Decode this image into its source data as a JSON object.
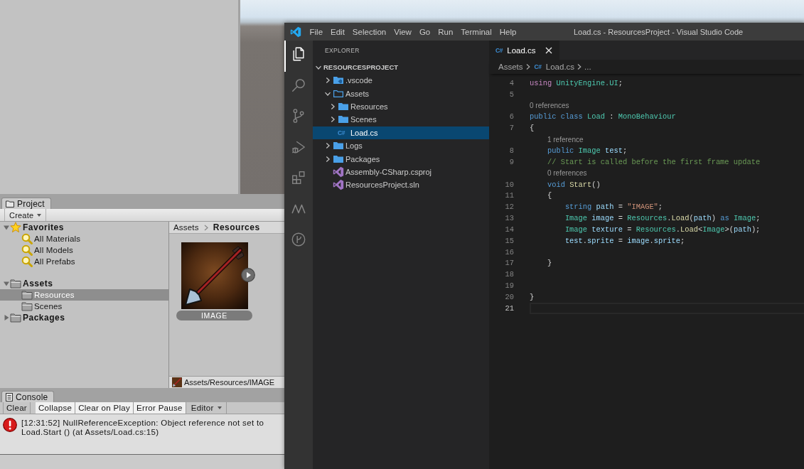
{
  "unity": {
    "project": {
      "tab": "Project",
      "create_button": "Create",
      "tree": [
        {
          "label": "Favorites",
          "kind": "favorites",
          "expanded": true,
          "selected": false,
          "children": [
            {
              "label": "All Materials",
              "kind": "search",
              "selected": false
            },
            {
              "label": "All Models",
              "kind": "search",
              "selected": false
            },
            {
              "label": "All Prefabs",
              "kind": "search",
              "selected": false
            }
          ]
        },
        {
          "label": "Assets",
          "kind": "folder",
          "expanded": true,
          "selected": false,
          "children": [
            {
              "label": "Resources",
              "kind": "folder",
              "selected": true
            },
            {
              "label": "Scenes",
              "kind": "folder",
              "selected": false
            }
          ]
        },
        {
          "label": "Packages",
          "kind": "folder",
          "expanded": false,
          "selected": false
        }
      ],
      "breadcrumb": [
        "Assets",
        "Resources"
      ],
      "assets": [
        {
          "label": "IMAGE",
          "selected": true
        }
      ],
      "path_bar": "Assets/Resources/IMAGE"
    },
    "console": {
      "tab": "Console",
      "toolbar": [
        {
          "label": "Clear",
          "kind": "button"
        },
        {
          "label": "Collapse",
          "kind": "toggle",
          "on": true
        },
        {
          "label": "Clear on Play",
          "kind": "toggle",
          "on": true
        },
        {
          "label": "Error Pause",
          "kind": "toggle",
          "on": true
        },
        {
          "label": "Editor",
          "kind": "dropdown"
        }
      ],
      "messages": [
        {
          "kind": "error",
          "lines": [
            "[12:31:52] NullReferenceException: Object reference not set to",
            "Load.Start () (at Assets/Load.cs:15)"
          ]
        }
      ]
    }
  },
  "vscode": {
    "menu": [
      "File",
      "Edit",
      "Selection",
      "View",
      "Go",
      "Run",
      "Terminal",
      "Help"
    ],
    "title": "Load.cs - ResourcesProject - Visual Studio Code",
    "activity_bar": [
      {
        "kind": "explorer",
        "selected": true
      },
      {
        "kind": "search",
        "selected": false
      },
      {
        "kind": "source-control",
        "selected": false
      },
      {
        "kind": "debug",
        "selected": false
      },
      {
        "kind": "extensions",
        "selected": false
      },
      {
        "kind": "zigzag",
        "selected": false
      },
      {
        "kind": "branch-circle",
        "selected": false
      }
    ],
    "sidebar": {
      "title": "EXPLORER",
      "tree": [
        {
          "label": "RESOURCESPROJECT",
          "kind": "workspace",
          "expanded": true,
          "selected": false,
          "children": [
            {
              "label": ".vscode",
              "kind": "vscode-folder",
              "expanded": false,
              "selected": false
            },
            {
              "label": "Assets",
              "kind": "folder",
              "expanded": true,
              "selected": false,
              "children": [
                {
                  "label": "Resources",
                  "kind": "folder",
                  "expanded": false,
                  "selected": false
                },
                {
                  "label": "Scenes",
                  "kind": "folder",
                  "expanded": false,
                  "selected": false
                },
                {
                  "label": "Load.cs",
                  "kind": "csharp",
                  "icon": "C#",
                  "selected": true
                }
              ]
            },
            {
              "label": "Logs",
              "kind": "folder",
              "expanded": false,
              "selected": false
            },
            {
              "label": "Packages",
              "kind": "folder",
              "expanded": false,
              "selected": false
            },
            {
              "label": "Assembly-CSharp.csproj",
              "kind": "project",
              "selected": false
            },
            {
              "label": "ResourcesProject.sln",
              "kind": "project",
              "selected": false
            }
          ]
        }
      ]
    },
    "editor": {
      "tabs": [
        {
          "label": "Load.cs",
          "icon": "C#",
          "selected": true
        }
      ],
      "breadcrumb": [
        {
          "label": "Assets"
        },
        {
          "label": "Load.cs",
          "icon": "C#"
        },
        {
          "label": "..."
        }
      ],
      "lines": [
        {
          "number": "4",
          "current": false,
          "tokens": [
            {
              "text": "using",
              "kind": "control"
            },
            {
              "text": " UnityEngine.UI",
              "kind": "type"
            },
            {
              "text": ";",
              "kind": "plain"
            }
          ]
        },
        {
          "number": "5",
          "current": false
        },
        {
          "number": "6",
          "current": false,
          "codelens": "0 references",
          "tokens": [
            {
              "text": "public class",
              "kind": "keyword"
            },
            {
              "text": " Load",
              "kind": "type"
            },
            {
              "text": " : ",
              "kind": "plain"
            },
            {
              "text": "MonoBehaviour",
              "kind": "type"
            }
          ]
        },
        {
          "number": "7",
          "current": false,
          "tokens": [
            {
              "text": "{",
              "kind": "plain"
            }
          ]
        },
        {
          "number": "8",
          "current": false,
          "codelens": "1 reference",
          "tokens": [
            {
              "text": "    public",
              "kind": "keyword"
            },
            {
              "text": " Image",
              "kind": "type"
            },
            {
              "text": " test",
              "kind": "variable"
            },
            {
              "text": ";",
              "kind": "plain"
            }
          ]
        },
        {
          "number": "9",
          "current": false,
          "tokens": [
            {
              "text": "    // Start is called before the first frame update",
              "kind": "comment"
            }
          ]
        },
        {
          "number": "10",
          "current": false,
          "codelens": "0 references",
          "tokens": [
            {
              "text": "    void",
              "kind": "keyword"
            },
            {
              "text": " Start",
              "kind": "function"
            },
            {
              "text": "()",
              "kind": "plain"
            }
          ]
        },
        {
          "number": "11",
          "current": false,
          "tokens": [
            {
              "text": "    {",
              "kind": "plain"
            }
          ]
        },
        {
          "number": "12",
          "current": false,
          "tokens": [
            {
              "text": "        string",
              "kind": "keyword"
            },
            {
              "text": " path",
              "kind": "variable"
            },
            {
              "text": " = ",
              "kind": "plain"
            },
            {
              "text": "\"IMAGE\"",
              "kind": "string"
            },
            {
              "text": ";",
              "kind": "plain"
            }
          ]
        },
        {
          "number": "13",
          "current": false,
          "tokens": [
            {
              "text": "        Image",
              "kind": "type"
            },
            {
              "text": " image",
              "kind": "variable"
            },
            {
              "text": " = ",
              "kind": "plain"
            },
            {
              "text": "Resources",
              "kind": "type"
            },
            {
              "text": ".",
              "kind": "plain"
            },
            {
              "text": "Load",
              "kind": "function"
            },
            {
              "text": "(",
              "kind": "plain"
            },
            {
              "text": "path",
              "kind": "variable"
            },
            {
              "text": ") ",
              "kind": "plain"
            },
            {
              "text": "as",
              "kind": "keyword"
            },
            {
              "text": " Image",
              "kind": "type"
            },
            {
              "text": ";",
              "kind": "plain"
            }
          ]
        },
        {
          "number": "14",
          "current": false,
          "tokens": [
            {
              "text": "        Image",
              "kind": "type"
            },
            {
              "text": " texture",
              "kind": "variable"
            },
            {
              "text": " = ",
              "kind": "plain"
            },
            {
              "text": "Resources",
              "kind": "type"
            },
            {
              "text": ".",
              "kind": "plain"
            },
            {
              "text": "Load",
              "kind": "function"
            },
            {
              "text": "<",
              "kind": "plain"
            },
            {
              "text": "Image",
              "kind": "type"
            },
            {
              "text": ">(",
              "kind": "plain"
            },
            {
              "text": "path",
              "kind": "variable"
            },
            {
              "text": ");",
              "kind": "plain"
            }
          ]
        },
        {
          "number": "15",
          "current": false,
          "tokens": [
            {
              "text": "        test",
              "kind": "variable"
            },
            {
              "text": ".",
              "kind": "plain"
            },
            {
              "text": "sprite",
              "kind": "variable"
            },
            {
              "text": " = ",
              "kind": "plain"
            },
            {
              "text": "image",
              "kind": "variable"
            },
            {
              "text": ".",
              "kind": "plain"
            },
            {
              "text": "sprite",
              "kind": "variable"
            },
            {
              "text": ";",
              "kind": "plain"
            }
          ]
        },
        {
          "number": "16",
          "current": false
        },
        {
          "number": "17",
          "current": false,
          "tokens": [
            {
              "text": "    }",
              "kind": "plain"
            }
          ]
        },
        {
          "number": "18",
          "current": false
        },
        {
          "number": "19",
          "current": false
        },
        {
          "number": "20",
          "current": false,
          "tokens": [
            {
              "text": "}",
              "kind": "plain"
            }
          ]
        },
        {
          "number": "21",
          "current": true
        }
      ]
    }
  }
}
